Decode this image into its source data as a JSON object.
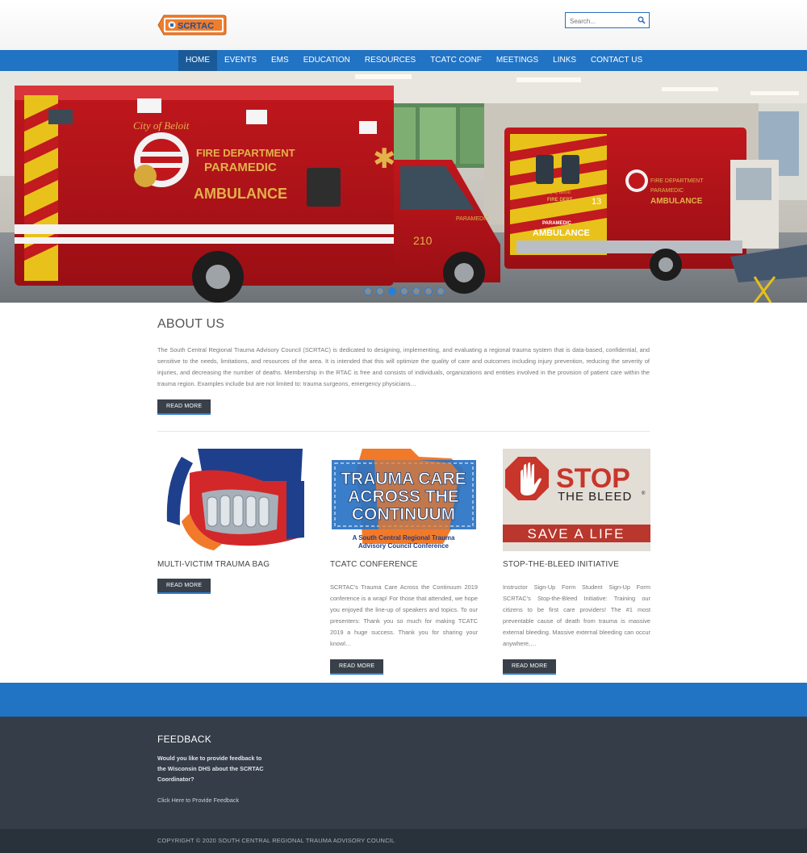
{
  "colors": {
    "nav": "#2173c4",
    "nav_active": "#1a5a99",
    "button": "#3a4049",
    "footer": "#343d48",
    "copyright_bg": "#29313b",
    "logo_orange": "#ef7d2e"
  },
  "header": {
    "logo_text": "SCRTAC",
    "search_placeholder": "Search...",
    "search_icon": "search-icon"
  },
  "nav": {
    "items": [
      "HOME",
      "EVENTS",
      "EMS",
      "EDUCATION",
      "RESOURCES",
      "TCATC CONF",
      "MEETINGS",
      "LINKS",
      "CONTACT US"
    ],
    "active": "HOME"
  },
  "hero": {
    "slide_count": 7,
    "active_slide": 3,
    "ambulance1": {
      "city": "City of Beloit",
      "line1": "FIRE DEPARTMENT",
      "line2": "PARAMEDIC",
      "line3": "AMBULANCE",
      "number": "210",
      "side": "PARAMEDIC"
    },
    "ambulance2": {
      "city": "City of Beloit",
      "line1": "FIRE DEPT.",
      "line2": "PARAMEDIC",
      "line3": "AMBULANCE",
      "number": "13",
      "side1": "FIRE DEPARTMENT",
      "side2": "PARAMEDIC",
      "side3": "AMBULANCE"
    }
  },
  "about": {
    "title": "ABOUT US",
    "body": "The South Central Regional Trauma Advisory Council (SCRTAC) is dedicated to designing, implementing, and evaluating a regional trauma system that is data-based, confidential, and sensitive to the needs, limitations, and resources of the area. It is intended that this will optimize the quality of care and outcomes including injury prevention, reducing the severity of injuries, and decreasing the number of deaths. Membership in the RTAC is free and consists of individuals, organizations and entities involved in the provision of patient care within the trauma region. Examples include but are not limited to: trauma surgeons, emergency physicians…",
    "button": "READ MORE"
  },
  "cards": [
    {
      "title": "MULTI-VICTIM TRAUMA BAG",
      "text": "",
      "button": "READ MORE"
    },
    {
      "title": "TCATC CONFERENCE",
      "text": "SCRTAC's Trauma Care Across the Continuum 2019 conference is a wrap!  For those that attended, we hope you enjoyed the line-up of speakers and topics. To our presenters:  Thank you so much for making TCATC 2019 a huge success. Thank you for sharing your knowl…",
      "button": "READ MORE",
      "image": {
        "line1": "TRAUMA CARE",
        "line2": "ACROSS THE",
        "line3": "CONTINUUM",
        "sub1": "A South Central Regional Trauma",
        "sub2": "Advisory Council Conference"
      }
    },
    {
      "title": "STOP-THE-BLEED INITIATIVE",
      "text": "Instructor Sign-Up Form Student Sign-Up Form SCRTAC's Stop-the-Bleed Initiative: Training our citizens to be first care providers! The #1 most preventable cause of death from trauma is massive external bleeding. Massive external bleeding can occur anywhere,…",
      "button": "READ MORE",
      "image": {
        "stop": "STOP",
        "bleed": "THE BLEED",
        "reg": "®",
        "save": "SAVE A LIFE"
      }
    }
  ],
  "footer": {
    "title": "FEEDBACK",
    "text": "Would you like to provide feedback to the Wisconsin DHS about the SCRTAC Coordinator?",
    "link": "Click Here to Provide Feedback"
  },
  "copyright": "COPYRIGHT © 2020 SOUTH CENTRAL REGIONAL TRAUMA ADVISORY COUNCIL"
}
